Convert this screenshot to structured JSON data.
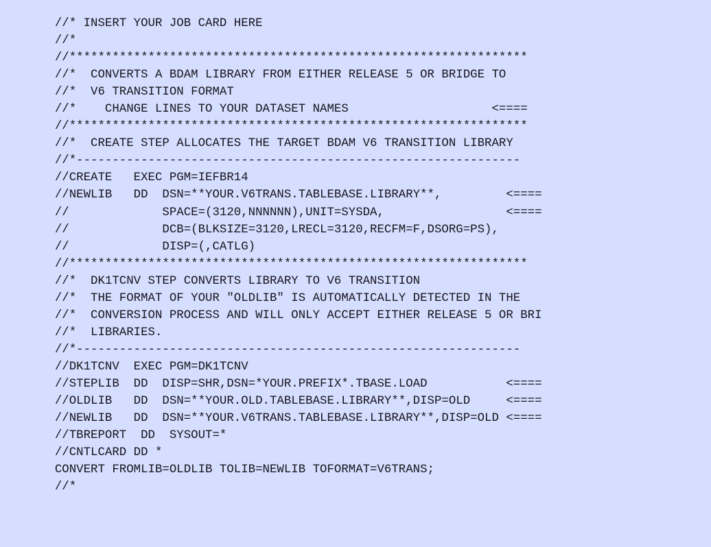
{
  "document": {
    "kind": "jcl-source-listing",
    "background_color": "#d6deff",
    "text_color": "#16161e",
    "line_count": 29,
    "lines": [
      "  //* INSERT YOUR JOB CARD HERE",
      "  //*",
      "  //****************************************************************",
      "  //*  CONVERTS A BDAM LIBRARY FROM EITHER RELEASE 5 OR BRIDGE TO",
      "  //*  V6 TRANSITION FORMAT",
      "  //*    CHANGE LINES TO YOUR DATASET NAMES                    <====",
      "  //****************************************************************",
      "  //*  CREATE STEP ALLOCATES THE TARGET BDAM V6 TRANSITION LIBRARY",
      "  //*--------------------------------------------------------------",
      "  //CREATE   EXEC PGM=IEFBR14",
      "  //NEWLIB   DD  DSN=**YOUR.V6TRANS.TABLEBASE.LIBRARY**,         <====",
      "  //             SPACE=(3120,NNNNNN),UNIT=SYSDA,                 <====",
      "  //             DCB=(BLKSIZE=3120,LRECL=3120,RECFM=F,DSORG=PS),",
      "  //             DISP=(,CATLG)",
      "  //****************************************************************",
      "  //*  DK1TCNV STEP CONVERTS LIBRARY TO V6 TRANSITION",
      "  //*  THE FORMAT OF YOUR \"OLDLIB\" IS AUTOMATICALLY DETECTED IN THE",
      "  //*  CONVERSION PROCESS AND WILL ONLY ACCEPT EITHER RELEASE 5 OR BRI",
      "  //*  LIBRARIES.",
      "  //*--------------------------------------------------------------",
      "  //DK1TCNV  EXEC PGM=DK1TCNV",
      "  //STEPLIB  DD  DISP=SHR,DSN=*YOUR.PREFIX*.TBASE.LOAD           <====",
      "  //OLDLIB   DD  DSN=**YOUR.OLD.TABLEBASE.LIBRARY**,DISP=OLD     <====",
      "  //NEWLIB   DD  DSN=**YOUR.V6TRANS.TABLEBASE.LIBRARY**,DISP=OLD <====",
      "  //TBREPORT  DD  SYSOUT=*",
      "  //CNTLCARD DD *",
      "  CONVERT FROMLIB=OLDLIB TOLIB=NEWLIB TOFORMAT=V6TRANS;",
      "  //*",
      ""
    ]
  }
}
